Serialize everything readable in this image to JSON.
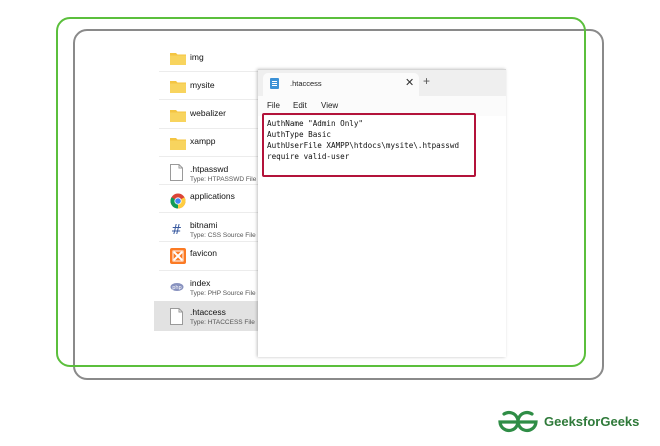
{
  "explorer": {
    "files": [
      {
        "name": "img",
        "type": "",
        "icon": "folder-icon"
      },
      {
        "name": "mysite",
        "type": "",
        "icon": "folder-icon"
      },
      {
        "name": "webalizer",
        "type": "",
        "icon": "folder-icon"
      },
      {
        "name": "xampp",
        "type": "",
        "icon": "folder-icon"
      },
      {
        "name": ".htpasswd",
        "type": "Type: HTPASSWD File",
        "icon": "document-icon"
      },
      {
        "name": "applications",
        "type": "",
        "icon": "chrome-icon"
      },
      {
        "name": "bitnami",
        "type": "Type: CSS Source File",
        "icon": "css-file-icon"
      },
      {
        "name": "favicon",
        "type": "",
        "icon": "xampp-icon"
      },
      {
        "name": "index",
        "type": "Type: PHP Source File",
        "icon": "php-file-icon"
      },
      {
        "name": ".htaccess",
        "type": "Type: HTACCESS File",
        "icon": "document-icon",
        "selected": true
      }
    ]
  },
  "notepad": {
    "tab_title": ".htaccess",
    "close_glyph": "✕",
    "add_glyph": "+",
    "menu": [
      "File",
      "Edit",
      "View"
    ],
    "lines": [
      "AuthName \"Admin Only\"",
      "AuthType Basic",
      "AuthUserFile XAMPP\\htdocs\\mysite\\.htpasswd",
      "require valid-user"
    ]
  },
  "brand": {
    "name": "GeeksforGeeks",
    "green": "#2f8d46",
    "frame_green": "#5bbf3c",
    "frame_gray": "#8a8a8a",
    "highlight": "#b3133a"
  }
}
